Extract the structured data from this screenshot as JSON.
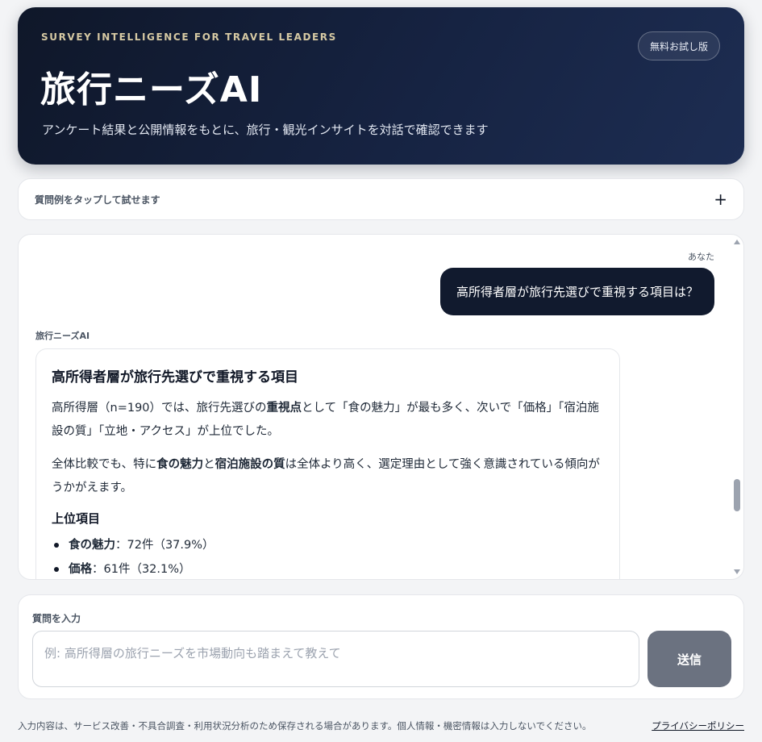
{
  "header": {
    "eyebrow": "SURVEY INTELLIGENCE FOR TRAVEL LEADERS",
    "title": "旅行ニーズAI",
    "subtitle": "アンケート結果と公開情報をもとに、旅行・観光インサイトを対話で確認できます",
    "trial_badge": "無料お試し版"
  },
  "examples": {
    "label": "質問例をタップして試せます",
    "toggle": "+"
  },
  "chat": {
    "user_label": "あなた",
    "user_message": "高所得者層が旅行先選びで重視する項目は？",
    "ai_label": "旅行ニーズAI",
    "ai_response": {
      "heading": "高所得者層が旅行先選びで重視する項目",
      "p1_a": "高所得層（n=190）では、旅行先選びの",
      "p1_bold": "重視点",
      "p1_b": "として「食の魅力」が最も多く、次いで「価格」「宿泊施設の質」「立地・アクセス」が上位でした。",
      "p2_a": "全体比較でも、特に",
      "p2_bold1": "食の魅力",
      "p2_b": "と",
      "p2_bold2": "宿泊施設の質",
      "p2_c": "は全体より高く、選定理由として強く意識されている傾向がうかがえます。",
      "list_heading": "上位項目",
      "items": [
        {
          "name": "食の魅力",
          "value": "：72件（37.9%）"
        },
        {
          "name": "価格",
          "value": "：61件（32.1%）"
        }
      ]
    }
  },
  "composer": {
    "label": "質問を入力",
    "placeholder": "例: 高所得層の旅行ニーズを市場動向も踏まえて教えて",
    "value": "",
    "send_label": "送信"
  },
  "footer": {
    "notice": "入力内容は、サービス改善・不具合調査・利用状況分析のため保存される場合があります。個人情報・機密情報は入力しないでください。",
    "privacy_link": "プライバシーポリシー"
  }
}
